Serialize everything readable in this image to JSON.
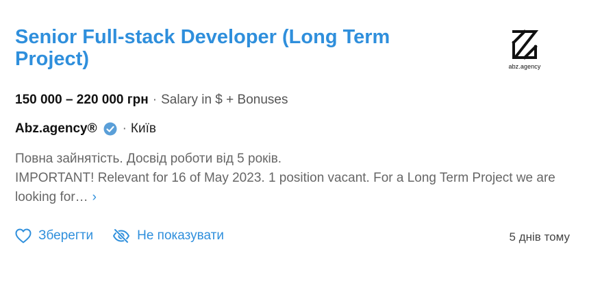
{
  "job": {
    "title": "Senior Full-stack Developer (Long Term Project)",
    "salary_range": "150 000 – 220 000 грн",
    "salary_separator": "·",
    "salary_note": "Salary in $ + Bonuses",
    "company": "Abz.agency®",
    "company_separator": "·",
    "city": "Київ",
    "description_line1": "Повна зайнятість. Досвід роботи від 5 років.",
    "description_line2": "IMPORTANT! Relevant for 16 of May 2023. 1 position vacant. For a Long Term Project we are looking for…",
    "more_chevron": "›",
    "posted": "5 днів тому"
  },
  "logo": {
    "text": "abz.agency",
    "icon": "abz-agency-logo"
  },
  "actions": {
    "save_label": "Зберегти",
    "save_icon": "heart-outline-icon",
    "hide_label": "Не показувати",
    "hide_icon": "eye-off-icon"
  },
  "colors": {
    "accent": "#2f8fdc",
    "verified_badge": "#5a9fd8"
  }
}
